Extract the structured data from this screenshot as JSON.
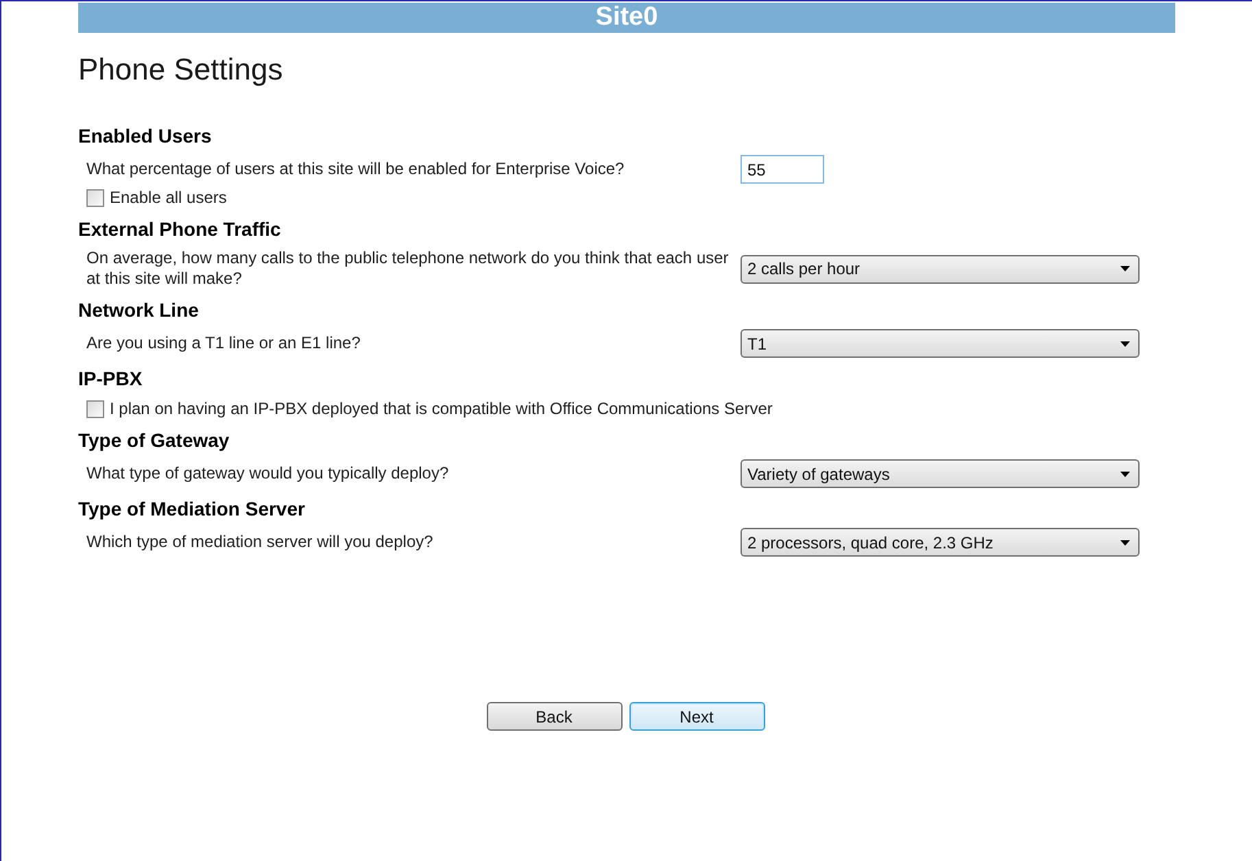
{
  "header": {
    "title": "Site0"
  },
  "page_title": "Phone Settings",
  "sections": [
    {
      "heading": "Enabled Users",
      "fields": [
        {
          "kind": "text",
          "label": "What percentage of users at this site will be enabled for Enterprise Voice?",
          "value": "55"
        },
        {
          "kind": "checkbox",
          "label": "Enable all users",
          "checked": false
        }
      ]
    },
    {
      "heading": "External Phone Traffic",
      "fields": [
        {
          "kind": "select",
          "label": "On average, how many calls to the public telephone network do you think that each user at this site will make?",
          "value": "2 calls per hour"
        }
      ]
    },
    {
      "heading": "Network Line",
      "fields": [
        {
          "kind": "select",
          "label": "Are you using a T1 line or an E1 line?",
          "value": "T1"
        }
      ]
    },
    {
      "heading": "IP-PBX",
      "fields": [
        {
          "kind": "checkbox",
          "label": "I plan on having an IP-PBX deployed that is compatible with Office Communications Server",
          "checked": false
        }
      ]
    },
    {
      "heading": "Type of Gateway",
      "fields": [
        {
          "kind": "select",
          "label": "What type of gateway would you typically deploy?",
          "value": "Variety of gateways"
        }
      ]
    },
    {
      "heading": "Type of Mediation Server",
      "fields": [
        {
          "kind": "select",
          "label": "Which type of mediation server will you deploy?",
          "value": "2 processors, quad core, 2.3 GHz"
        }
      ]
    }
  ],
  "buttons": [
    {
      "label": "Back",
      "focused": false
    },
    {
      "label": "Next",
      "focused": true
    }
  ]
}
